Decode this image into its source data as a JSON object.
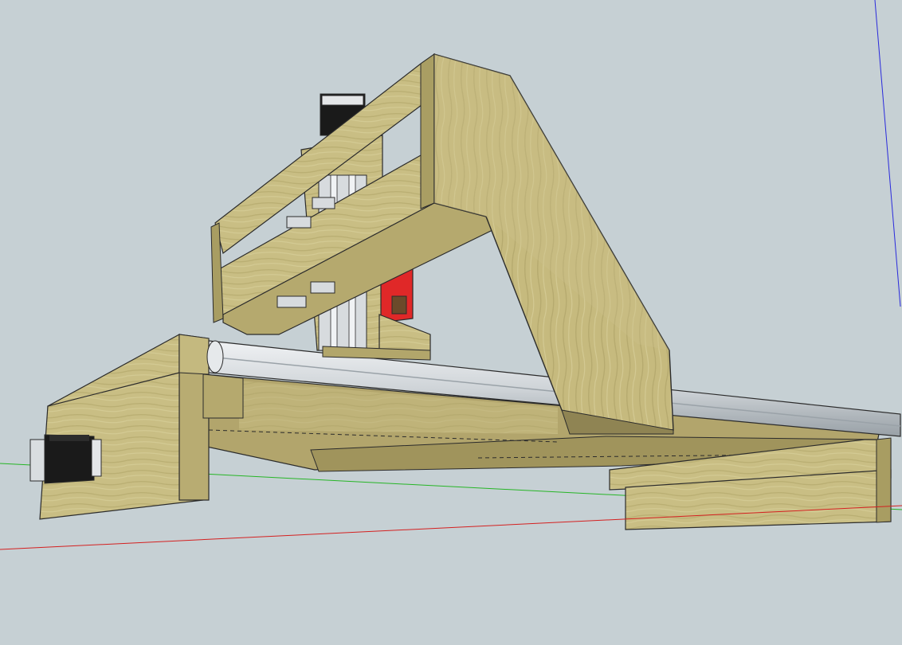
{
  "viewport": {
    "background": "#c6d0d4",
    "axis_colors": {
      "red": "#d42020",
      "green": "#26b526",
      "blue": "#2a2adc"
    }
  },
  "materials": {
    "wood": "#c8bd82",
    "wood_dark": "#a89d62",
    "wood_shadow": "#8f8453",
    "rail": "#d9dde0",
    "rail_shadow": "#9ea6ab",
    "spindle": "#e02828",
    "motor": "#1a1a1a"
  }
}
